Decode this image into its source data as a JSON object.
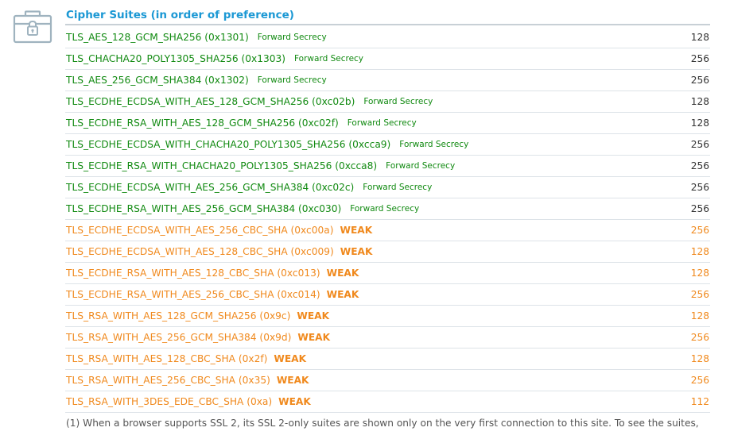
{
  "section": {
    "title": "Cipher Suites (in order of preference)",
    "icon": "toolbox-lock-icon"
  },
  "colors": {
    "title": "#1b98d4",
    "secure": "#118a11",
    "weak": "#f0891d"
  },
  "suites": [
    {
      "name": "TLS_AES_128_GCM_SHA256 (0x1301)",
      "tag": "Forward Secrecy",
      "bits": "128",
      "status": "good"
    },
    {
      "name": "TLS_CHACHA20_POLY1305_SHA256 (0x1303)",
      "tag": "Forward Secrecy",
      "bits": "256",
      "status": "good"
    },
    {
      "name": "TLS_AES_256_GCM_SHA384 (0x1302)",
      "tag": "Forward Secrecy",
      "bits": "256",
      "status": "good"
    },
    {
      "name": "TLS_ECDHE_ECDSA_WITH_AES_128_GCM_SHA256 (0xc02b)",
      "tag": "Forward Secrecy",
      "bits": "128",
      "status": "good"
    },
    {
      "name": "TLS_ECDHE_RSA_WITH_AES_128_GCM_SHA256 (0xc02f)",
      "tag": "Forward Secrecy",
      "bits": "128",
      "status": "good"
    },
    {
      "name": "TLS_ECDHE_ECDSA_WITH_CHACHA20_POLY1305_SHA256 (0xcca9)",
      "tag": "Forward Secrecy",
      "bits": "256",
      "status": "good"
    },
    {
      "name": "TLS_ECDHE_RSA_WITH_CHACHA20_POLY1305_SHA256 (0xcca8)",
      "tag": "Forward Secrecy",
      "bits": "256",
      "status": "good"
    },
    {
      "name": "TLS_ECDHE_ECDSA_WITH_AES_256_GCM_SHA384 (0xc02c)",
      "tag": "Forward Secrecy",
      "bits": "256",
      "status": "good"
    },
    {
      "name": "TLS_ECDHE_RSA_WITH_AES_256_GCM_SHA384 (0xc030)",
      "tag": "Forward Secrecy",
      "bits": "256",
      "status": "good"
    },
    {
      "name": "TLS_ECDHE_ECDSA_WITH_AES_256_CBC_SHA (0xc00a)",
      "tag": "WEAK",
      "bits": "256",
      "status": "weak"
    },
    {
      "name": "TLS_ECDHE_ECDSA_WITH_AES_128_CBC_SHA (0xc009)",
      "tag": "WEAK",
      "bits": "128",
      "status": "weak"
    },
    {
      "name": "TLS_ECDHE_RSA_WITH_AES_128_CBC_SHA (0xc013)",
      "tag": "WEAK",
      "bits": "128",
      "status": "weak"
    },
    {
      "name": "TLS_ECDHE_RSA_WITH_AES_256_CBC_SHA (0xc014)",
      "tag": "WEAK",
      "bits": "256",
      "status": "weak"
    },
    {
      "name": "TLS_RSA_WITH_AES_128_GCM_SHA256 (0x9c)",
      "tag": "WEAK",
      "bits": "128",
      "status": "weak"
    },
    {
      "name": "TLS_RSA_WITH_AES_256_GCM_SHA384 (0x9d)",
      "tag": "WEAK",
      "bits": "256",
      "status": "weak"
    },
    {
      "name": "TLS_RSA_WITH_AES_128_CBC_SHA (0x2f)",
      "tag": "WEAK",
      "bits": "128",
      "status": "weak"
    },
    {
      "name": "TLS_RSA_WITH_AES_256_CBC_SHA (0x35)",
      "tag": "WEAK",
      "bits": "256",
      "status": "weak"
    },
    {
      "name": "TLS_RSA_WITH_3DES_EDE_CBC_SHA (0xa)",
      "tag": "WEAK",
      "bits": "112",
      "status": "weak"
    }
  ],
  "footnote": "(1) When a browser supports SSL 2, its SSL 2-only suites are shown only on the very first connection to this site. To see the suites,"
}
